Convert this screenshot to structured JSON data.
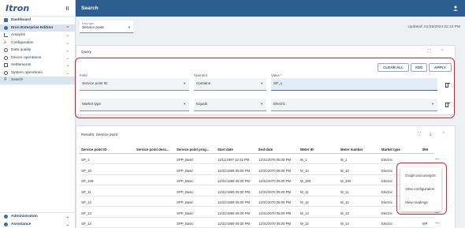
{
  "app": {
    "brand": "Itron"
  },
  "sidebar": {
    "items": [
      {
        "label": "Dashboard",
        "icon": "dashboard-icon"
      },
      {
        "label": "Itron Enterprise Edition",
        "icon": "itron-icon"
      },
      {
        "label": "Analysis"
      },
      {
        "label": "Configuration"
      },
      {
        "label": "Data quality"
      },
      {
        "label": "Device operations"
      },
      {
        "label": "Settlements"
      },
      {
        "label": "System operations"
      },
      {
        "label": "Search"
      }
    ],
    "bottom": [
      {
        "label": "Administration"
      },
      {
        "label": "Assistance"
      }
    ]
  },
  "topbar": {
    "title": "Search"
  },
  "entry_type": {
    "label": "Entry type",
    "value": "Service point"
  },
  "updated": "Updated: 01/25/2024 02:10 PM",
  "query": {
    "title": "Query",
    "buttons": {
      "clear_all": "CLEAR ALL",
      "add": "ADD",
      "apply": "APPLY"
    },
    "labels": {
      "field": "Field",
      "operator": "Operator",
      "value": "Value *"
    },
    "rows": [
      {
        "field": "Service point ID",
        "operator": "Contains",
        "value": "SP_1"
      },
      {
        "field": "Market type",
        "operator": "Equals",
        "value": "Electric"
      }
    ]
  },
  "results": {
    "title": "Results: Service point",
    "columns": [
      "Service point ID",
      "Service point desc...",
      "Service point prog...",
      "Start date",
      "End date",
      "Meter ID",
      "Meter number",
      "Market type",
      "Met"
    ],
    "sort_icon": "arrow-up-icon",
    "rows": [
      [
        "SP_1",
        "",
        "SPP_Basic",
        "11/11/1997 12:41 PM",
        "12/31/2070 05:00 PM",
        "M_1",
        "M_1",
        "Electric",
        ""
      ],
      [
        "SP_10",
        "",
        "SPP_Basic",
        "12/31/1969 05:00 PM",
        "12/31/2070 05:00 PM",
        "M_10",
        "M_10",
        "Electric",
        ""
      ],
      [
        "SP_100",
        "",
        "SPP_Basic",
        "12/31/1969 05:00 PM",
        "12/31/2070 05:00 PM",
        "M_100",
        "M_100",
        "Electric",
        ""
      ],
      [
        "SP_11",
        "",
        "SPP_Basic",
        "12/31/1969 05:00 PM",
        "12/31/2070 05:00 PM",
        "M_11",
        "M_11",
        "Electric",
        ""
      ],
      [
        "SP_12",
        "",
        "SPP_Basic",
        "12/31/1969 05:00 PM",
        "12/31/2070 05:00 PM",
        "M_12",
        "M_12",
        "Electric",
        ""
      ],
      [
        "SP_13",
        "",
        "SPP_Basic",
        "12/31/1969 05:00 PM",
        "12/31/2070 05:00 PM",
        "M_13",
        "M_13",
        "Electric",
        ""
      ],
      [
        "SP_14",
        "",
        "SPP_Basic",
        "12/31/1969 05:00 PM",
        "12/31/2070 05:00 PM",
        "M_14",
        "M_14",
        "Electric",
        "MP"
      ]
    ],
    "row_menu": "..."
  },
  "context_menu": {
    "items": [
      "Graph and analyze",
      "View configuration",
      "View readings"
    ]
  },
  "colors": {
    "topbar": "#2c5e8f",
    "highlight": "#e0242b",
    "active_nav": "#d9e4ef"
  }
}
